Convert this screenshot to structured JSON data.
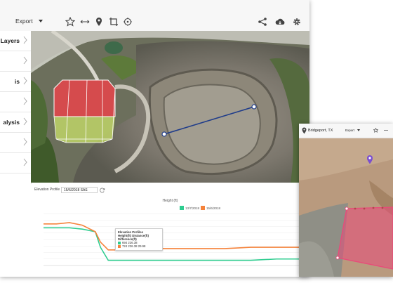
{
  "toolbar": {
    "export_label": "Export",
    "icons": [
      "star-icon",
      "measure-distance-icon",
      "location-pin-icon",
      "crop-icon",
      "target-icon",
      "share-icon",
      "cloud-download-icon",
      "gear-icon"
    ]
  },
  "sidebar": {
    "items": [
      {
        "label": "Layers"
      },
      {
        "label": ""
      },
      {
        "label": "is"
      },
      {
        "label": ""
      },
      {
        "label": "alysis"
      },
      {
        "label": ""
      },
      {
        "label": ""
      }
    ]
  },
  "profile": {
    "label": "Elevation Profile",
    "date": "15/6/2018 SAS",
    "chart_title": "Height (ft)",
    "tooltip": {
      "title": "Elevation Profiles",
      "header": "Height(ft) Distance(ft) Difference(ft)",
      "row1": "694      226.38",
      "row2": "724      226.38      29.98"
    }
  },
  "second_window": {
    "location": "Bridgeport, TX",
    "export_label": "Export"
  },
  "colors": {
    "series_a": "#2ecc8f",
    "series_b": "#f5823a",
    "profile_line": "#1f3c8a",
    "volume_top": "#e8454a",
    "volume_base": "#c9e26a",
    "area_polygon": "#e94a7a"
  },
  "chart_data": {
    "type": "line",
    "title": "Height (ft)",
    "xlabel": "",
    "ylabel": "",
    "x": [
      0,
      5,
      10,
      15,
      20,
      22,
      25,
      30,
      40,
      50,
      60,
      70,
      80,
      90,
      100
    ],
    "series": [
      {
        "name": "13/7/2018",
        "values": [
          719,
          719,
          719,
          718,
          716,
          704,
          694,
          694,
          694,
          694,
          694,
          694,
          694,
          695,
          695
        ]
      },
      {
        "name": "15/6/2018",
        "values": [
          722,
          722,
          723,
          721,
          716,
          708,
          702,
          702,
          703,
          703,
          703,
          703,
          704,
          704,
          704
        ]
      }
    ],
    "ylim": [
      690,
      730
    ],
    "grid": true,
    "legend": "top-center"
  }
}
